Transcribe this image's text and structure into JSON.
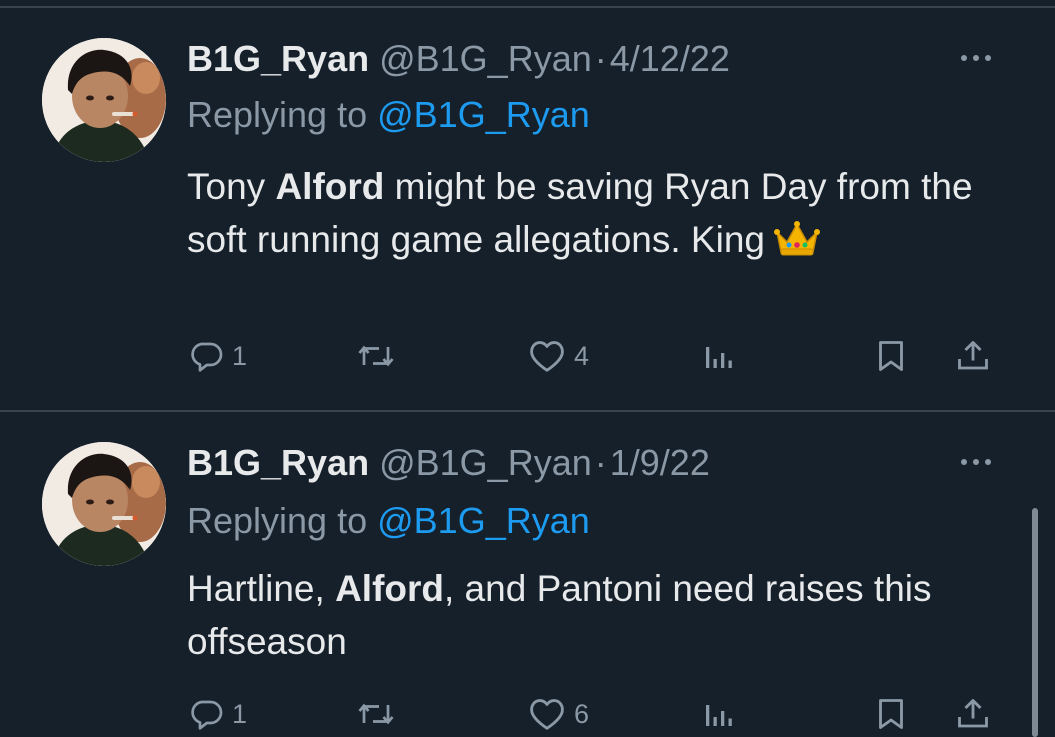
{
  "tweets": [
    {
      "display_name": "B1G_Ryan",
      "handle": "@B1G_Ryan",
      "separator": "·",
      "date": "4/12/22",
      "replying_prefix": "Replying to",
      "replying_to": "@B1G_Ryan",
      "text_parts": [
        "Tony ",
        "Alford",
        " might be saving Ryan Day from the soft running game allegations. King"
      ],
      "emoji": "crown-emoji",
      "reply_count": "1",
      "retweet_count": "",
      "like_count": "4"
    },
    {
      "display_name": "B1G_Ryan",
      "handle": "@B1G_Ryan",
      "separator": "·",
      "date": "1/9/22",
      "replying_prefix": "Replying to",
      "replying_to": "@B1G_Ryan",
      "text_parts": [
        "Hartline, ",
        "Alford",
        ", and Pantoni need raises this offseason"
      ],
      "reply_count": "1",
      "retweet_count": "",
      "like_count": "6"
    }
  ],
  "icons": {
    "reply": "reply-icon",
    "retweet": "retweet-icon",
    "like": "heart-icon",
    "views": "views-icon",
    "bookmark": "bookmark-icon",
    "share": "share-icon",
    "more": "more-icon"
  },
  "colors": {
    "background": "#15202b",
    "text": "#e7e9ea",
    "muted": "#8b98a5",
    "link": "#1d9bf0",
    "divider": "#38444d"
  }
}
